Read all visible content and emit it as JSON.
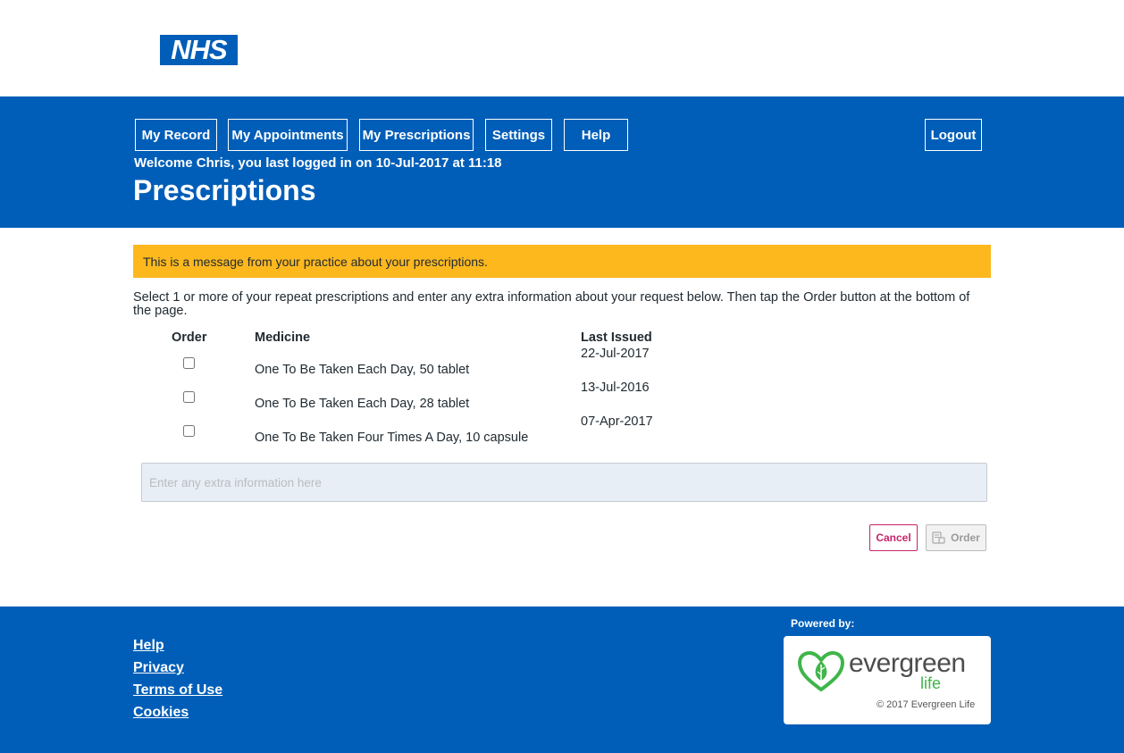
{
  "logo_text": "NHS",
  "nav": {
    "my_record": "My Record",
    "my_appointments": "My Appointments",
    "my_prescriptions": "My Prescriptions",
    "settings": "Settings",
    "help": "Help",
    "logout": "Logout"
  },
  "welcome": "Welcome Chris, you last logged in on 10-Jul-2017 at 11:18",
  "page_title": "Prescriptions",
  "alert": "This is a message from your practice about your prescriptions.",
  "intro": "Select 1 or more of your repeat prescriptions and enter any extra information about your request below. Then tap the Order button at the bottom of the page.",
  "table": {
    "headers": {
      "order": "Order",
      "medicine": "Medicine",
      "last_issued": "Last Issued"
    },
    "rows": [
      {
        "medicine": "One To Be Taken Each Day, 50 tablet",
        "last_issued": "22-Jul-2017",
        "checked": false
      },
      {
        "medicine": "One To Be Taken Each Day, 28 tablet",
        "last_issued": "13-Jul-2016",
        "checked": false
      },
      {
        "medicine": "One To Be Taken Four Times A Day, 10 capsule",
        "last_issued": "07-Apr-2017",
        "checked": false
      }
    ]
  },
  "extra_info": {
    "placeholder": "Enter any extra information here",
    "value": ""
  },
  "actions": {
    "cancel": "Cancel",
    "order": "Order"
  },
  "footer": {
    "links": [
      "Help",
      "Privacy",
      "Terms of Use",
      "Cookies"
    ],
    "powered_by": "Powered by:",
    "brand_name": "evergreen",
    "brand_sub": "life",
    "copyright": "© 2017 Evergreen Life"
  },
  "colors": {
    "nhs_blue": "#005eb8",
    "alert_yellow": "#fdb81e",
    "cancel_pink": "#c8246a",
    "evergreen_green": "#3fb54a"
  }
}
